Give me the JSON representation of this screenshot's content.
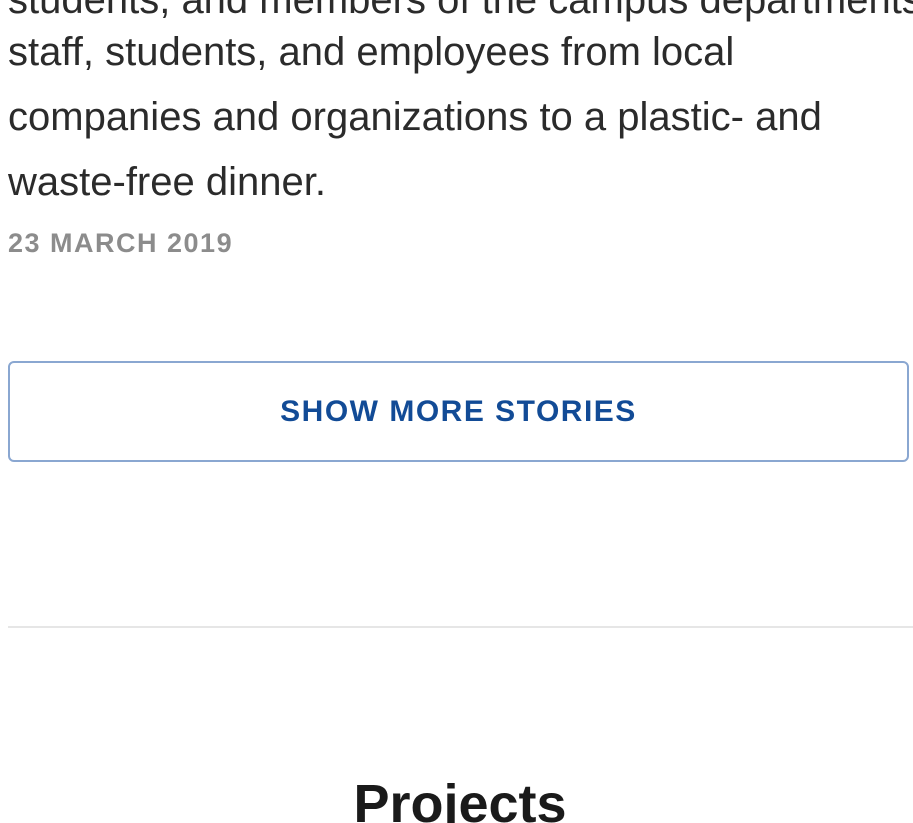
{
  "story": {
    "clipped_line": "students, and members of the campus departments,",
    "text": "staff, students, and employees from local companies and organizations to a plastic- and waste-free dinner.",
    "date": "23 MARCH 2019"
  },
  "actions": {
    "show_more_label": "SHOW MORE STORIES"
  },
  "sections": {
    "projects_title": "Projects"
  }
}
